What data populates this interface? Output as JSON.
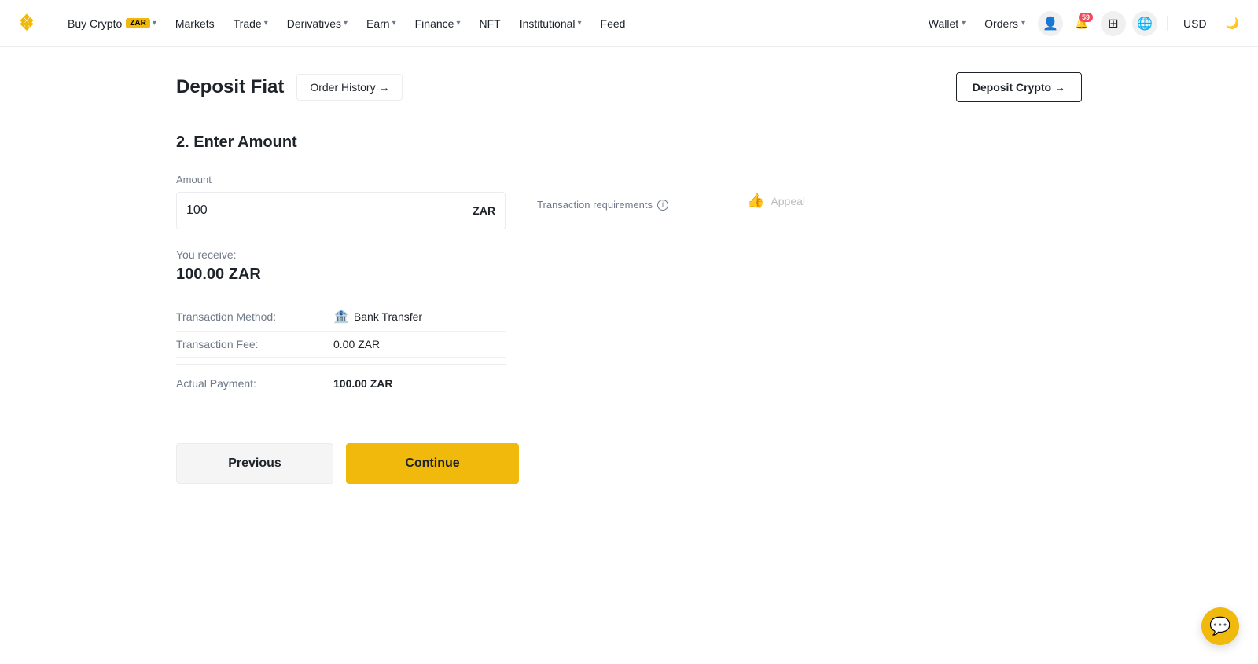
{
  "brand": {
    "name": "Binance"
  },
  "navbar": {
    "buy_crypto_label": "Buy Crypto",
    "buy_crypto_badge": "ZAR",
    "markets_label": "Markets",
    "trade_label": "Trade",
    "derivatives_label": "Derivatives",
    "earn_label": "Earn",
    "finance_label": "Finance",
    "nft_label": "NFT",
    "institutional_label": "Institutional",
    "feed_label": "Feed",
    "wallet_label": "Wallet",
    "orders_label": "Orders",
    "notification_count": "59",
    "currency_label": "USD"
  },
  "page": {
    "title": "Deposit Fiat",
    "order_history_label": "Order History →",
    "deposit_crypto_label": "Deposit Crypto →"
  },
  "form": {
    "section_title": "2. Enter Amount",
    "amount_label": "Amount",
    "amount_value": "100",
    "currency": "ZAR",
    "tx_requirements_label": "Transaction requirements",
    "appeal_label": "Appeal",
    "you_receive_label": "You receive:",
    "you_receive_amount": "100.00 ZAR",
    "transaction_method_label": "Transaction Method:",
    "transaction_method_value": "Bank Transfer",
    "transaction_fee_label": "Transaction Fee:",
    "transaction_fee_value": "0.00 ZAR",
    "actual_payment_label": "Actual Payment:",
    "actual_payment_value": "100.00 ZAR"
  },
  "buttons": {
    "previous_label": "Previous",
    "continue_label": "Continue"
  }
}
